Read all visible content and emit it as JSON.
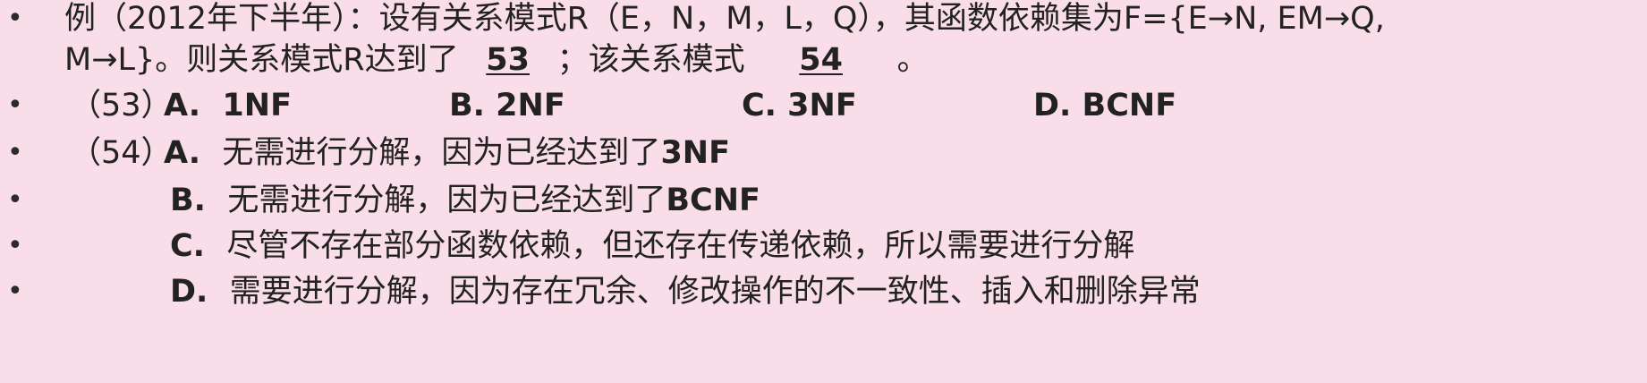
{
  "question": {
    "line1": "例（2012年下半年）：设有关系模式R（E，N，M，L，Q），其函数依赖集为F={E→N, EM→Q,",
    "line2_prefix": "M→L}。则关系模式R达到了",
    "blank53_text": "53",
    "line2_mid": "；该关系模式",
    "blank54_text": "54",
    "line2_suffix": "。"
  },
  "q53": {
    "label": "（53）",
    "options": [
      {
        "letter": "A.",
        "text": "1NF"
      },
      {
        "letter": "B.",
        "text": "2NF"
      },
      {
        "letter": "C.",
        "text": "3NF"
      },
      {
        "letter": "D.",
        "text": "BCNF"
      }
    ]
  },
  "q54": {
    "label": "（54）",
    "options": [
      {
        "letter": "A.",
        "text_cn": "无需进行分解，因为已经达到了",
        "text_en": "3NF"
      },
      {
        "letter": "B.",
        "text_cn": "无需进行分解，因为已经达到了",
        "text_en": "BCNF"
      },
      {
        "letter": "C.",
        "text_cn": "尽管不存在部分函数依赖，但还存在传递依赖，所以需要进行分解",
        "text_en": ""
      },
      {
        "letter": "D.",
        "text_cn": "需要进行分解，因为存在冗余、修改操作的不一致性、插入和删除异常",
        "text_en": ""
      }
    ]
  },
  "bullet_symbol": "•"
}
